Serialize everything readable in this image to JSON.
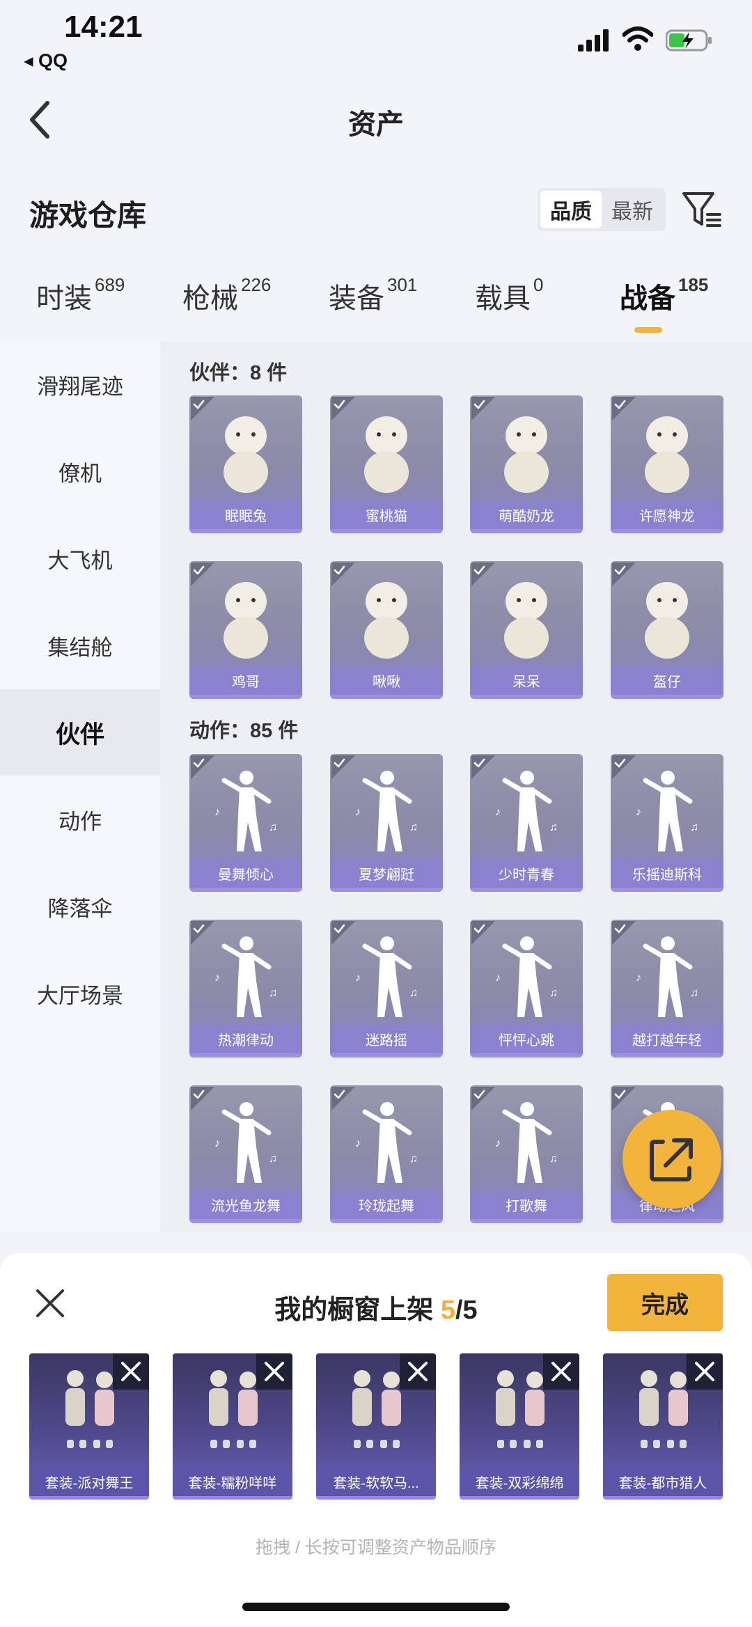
{
  "status_bar": {
    "time": "14:21",
    "back_app": "◂ QQ"
  },
  "header": {
    "title": "资产"
  },
  "warehouse": {
    "title": "游戏仓库",
    "sort_options": [
      "品质",
      "最新"
    ],
    "sort_selected": "品质",
    "filter_icon": "filter-icon"
  },
  "tabs": [
    {
      "label": "时装",
      "count": "689"
    },
    {
      "label": "枪械",
      "count": "226"
    },
    {
      "label": "装备",
      "count": "301"
    },
    {
      "label": "载具",
      "count": "0"
    },
    {
      "label": "战备",
      "count": "185",
      "active": true
    }
  ],
  "sidebar": [
    {
      "label": "滑翔尾迹"
    },
    {
      "label": "僚机"
    },
    {
      "label": "大飞机"
    },
    {
      "label": "集结舱"
    },
    {
      "label": "伙伴",
      "active": true
    },
    {
      "label": "动作"
    },
    {
      "label": "降落伞"
    },
    {
      "label": "大厅场景"
    }
  ],
  "groups": [
    {
      "title": "伙伴：8 件",
      "items": [
        "眠眠兔",
        "蜜桃猫",
        "萌酷奶龙",
        "许愿神龙",
        "鸡哥",
        "啾啾",
        "呆呆",
        "盔仔"
      ]
    },
    {
      "title": "动作：85 件",
      "items": [
        "曼舞倾心",
        "夏梦翩跹",
        "少时青春",
        "乐摇迪斯科",
        "热潮律动",
        "迷路摇",
        "怦怦心跳",
        "越打越年轻",
        "流光鱼龙舞",
        "玲珑起舞",
        "打歌舞",
        "律动之风"
      ]
    }
  ],
  "showcase": {
    "title_prefix": "我的橱窗上架 ",
    "count_current": "5",
    "count_total": "/5",
    "done_label": "完成",
    "items": [
      "套装-派对舞王",
      "套装-糯粉咩咩",
      "套装-软软马...",
      "套装-双彩绵绵",
      "套装-都市猎人"
    ],
    "hint": "拖拽 / 长按可调整资产物品顺序"
  },
  "colors": {
    "accent": "#f2b43a",
    "card": "#8b8aa8",
    "card_label": "#8c80dc"
  }
}
